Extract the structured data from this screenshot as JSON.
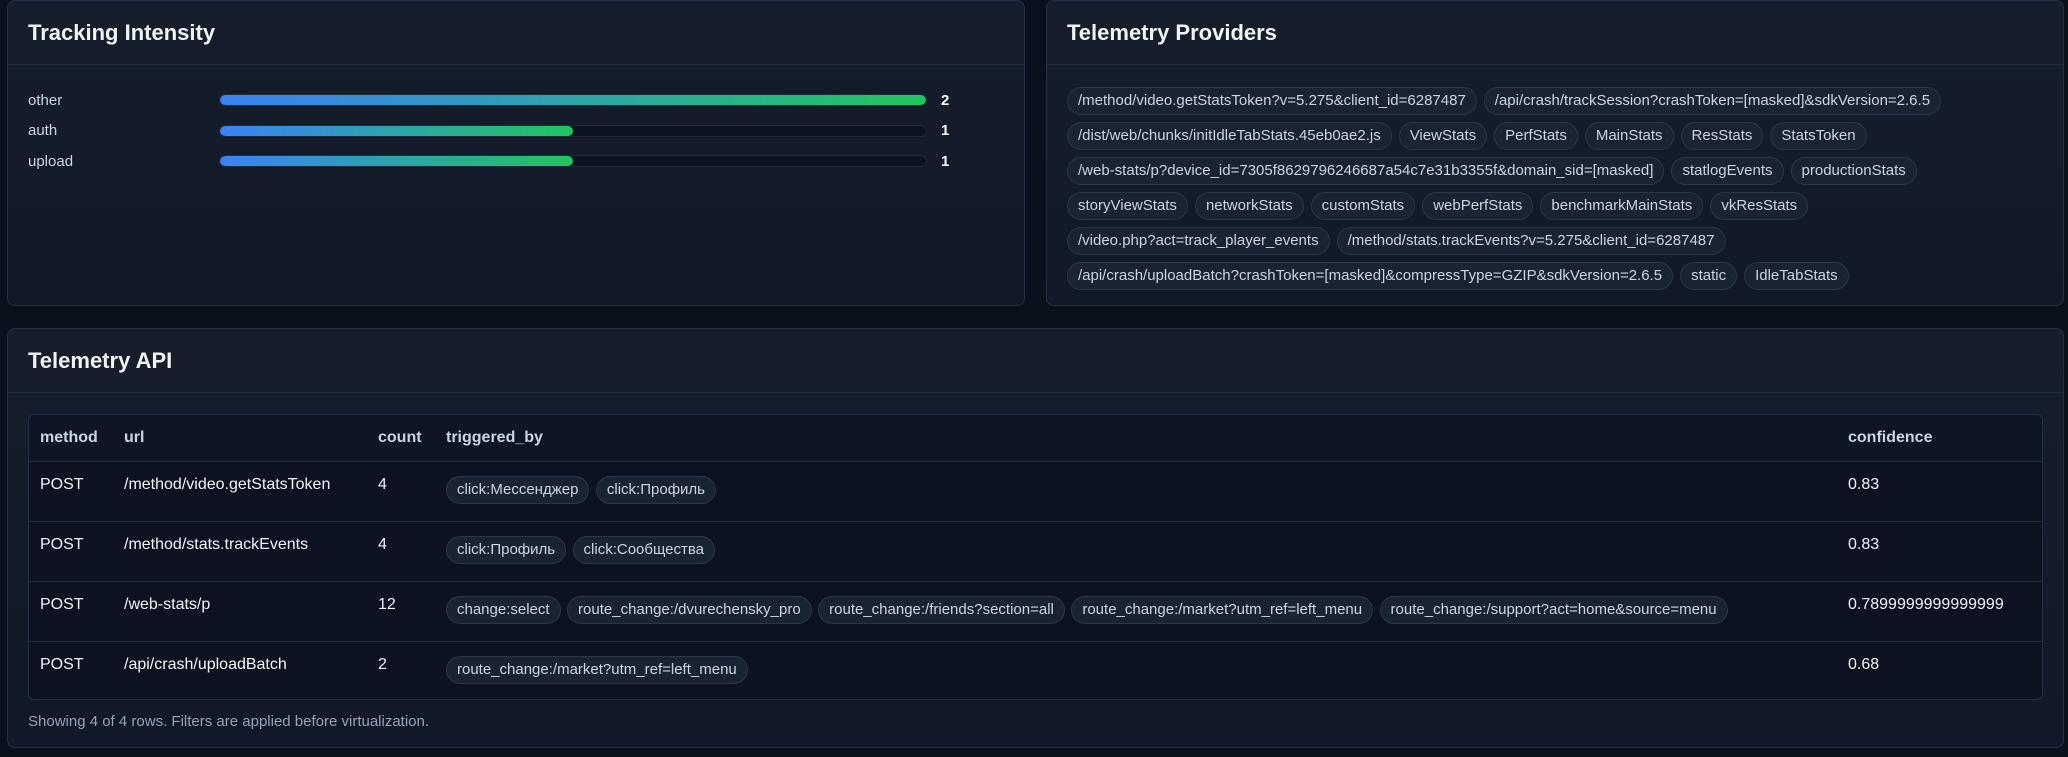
{
  "intensity": {
    "title": "Tracking Intensity",
    "max": 2,
    "rows": [
      {
        "label": "other",
        "value": 2
      },
      {
        "label": "auth",
        "value": 1
      },
      {
        "label": "upload",
        "value": 1
      }
    ]
  },
  "providers": {
    "title": "Telemetry Providers",
    "chips": [
      "/method/video.getStatsToken?v=5.275&client_id=6287487",
      "/api/crash/trackSession?crashToken=[masked]&sdkVersion=2.6.5",
      "/dist/web/chunks/initIdleTabStats.45eb0ae2.js",
      "ViewStats",
      "PerfStats",
      "MainStats",
      "ResStats",
      "StatsToken",
      "/web-stats/p?device_id=7305f8629796246687a54c7e31b3355f&domain_sid=[masked]",
      "statlogEvents",
      "productionStats",
      "storyViewStats",
      "networkStats",
      "customStats",
      "webPerfStats",
      "benchmarkMainStats",
      "vkResStats",
      "/video.php?act=track_player_events",
      "/method/stats.trackEvents?v=5.275&client_id=6287487",
      "/api/crash/uploadBatch?crashToken=[masked]&compressType=GZIP&sdkVersion=2.6.5",
      "static",
      "IdleTabStats"
    ]
  },
  "api": {
    "title": "Telemetry API",
    "columns": [
      "method",
      "url",
      "count",
      "triggered_by",
      "confidence"
    ],
    "rows": [
      {
        "method": "POST",
        "url": "/method/video.getStatsToken",
        "count": "4",
        "triggered_by": [
          "click:Мессенджер",
          "click:Профиль"
        ],
        "confidence": "0.83"
      },
      {
        "method": "POST",
        "url": "/method/stats.trackEvents",
        "count": "4",
        "triggered_by": [
          "click:Профиль",
          "click:Сообщества"
        ],
        "confidence": "0.83"
      },
      {
        "method": "POST",
        "url": "/web-stats/p",
        "count": "12",
        "triggered_by": [
          "change:select",
          "route_change:/dvurechensky_pro",
          "route_change:/friends?section=all",
          "route_change:/market?utm_ref=left_menu",
          "route_change:/support?act=home&source=menu"
        ],
        "confidence": "0.7899999999999999"
      },
      {
        "method": "POST",
        "url": "/api/crash/uploadBatch",
        "count": "2",
        "triggered_by": [
          "route_change:/market?utm_ref=left_menu"
        ],
        "confidence": "0.68"
      }
    ],
    "footer": "Showing 4 of 4 rows. Filters are applied before virtualization."
  }
}
